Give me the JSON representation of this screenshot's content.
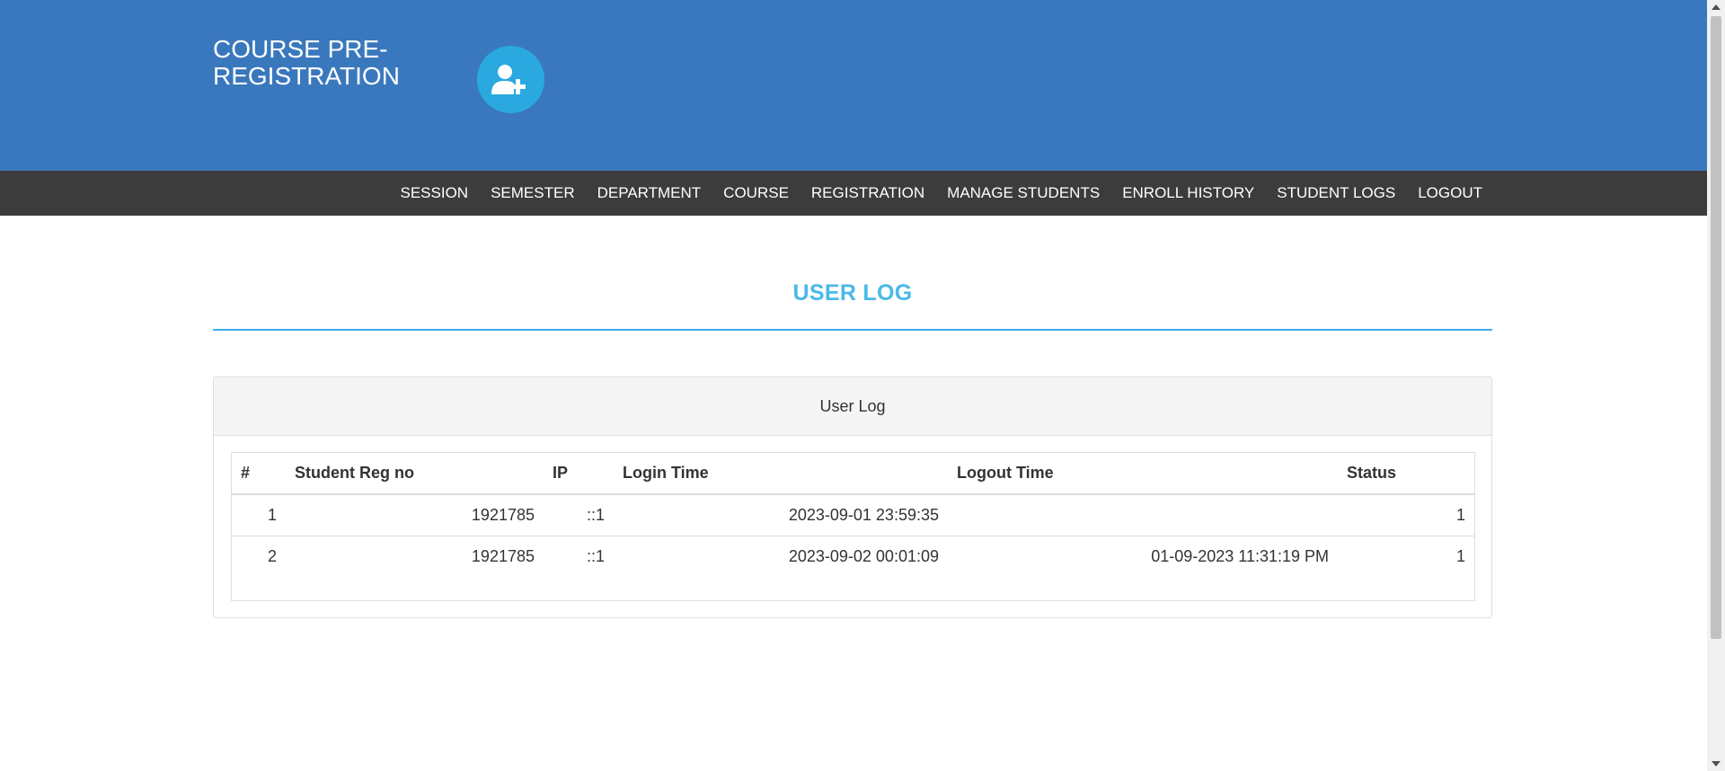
{
  "brand": {
    "title": "COURSE PRE-REGISTRATION",
    "icon": "user-plus-icon"
  },
  "nav": {
    "items": [
      "SESSION",
      "SEMESTER",
      "DEPARTMENT",
      "COURSE",
      "REGISTRATION",
      "MANAGE STUDENTS",
      "ENROLL HISTORY",
      "STUDENT LOGS",
      "LOGOUT"
    ]
  },
  "page": {
    "title": "USER LOG"
  },
  "panel": {
    "heading": "User Log"
  },
  "table": {
    "headers": [
      "#",
      "Student Reg no",
      "IP",
      "Login Time",
      "Logout Time",
      "Status"
    ],
    "rows": [
      [
        "1",
        "1921785",
        "::1",
        "2023-09-01 23:59:35",
        "",
        "1"
      ],
      [
        "2",
        "1921785",
        "::1",
        "2023-09-02 00:01:09",
        "01-09-2023 11:31:19 PM",
        "1"
      ]
    ]
  },
  "colors": {
    "header_bg": "#3a78bd",
    "nav_bg": "#3c3c3c",
    "accent": "#4ab9e8",
    "logo_bg": "#29a9e0"
  }
}
